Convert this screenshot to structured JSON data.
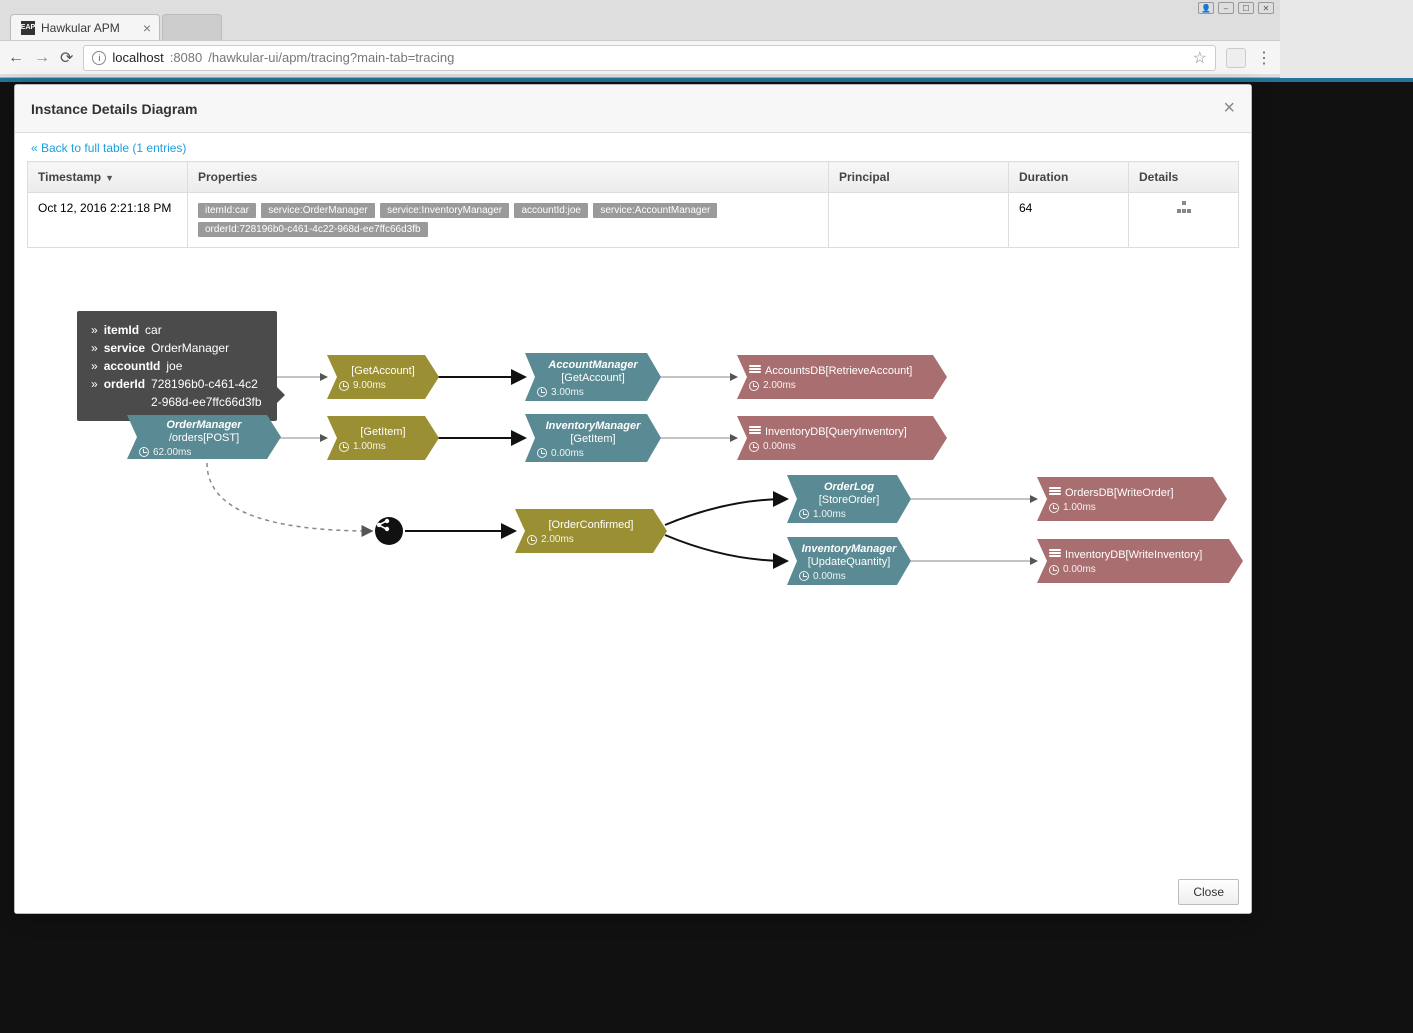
{
  "browser": {
    "tab_title": "Hawkular APM",
    "url_host": "localhost",
    "url_port": ":8080",
    "url_path": "/hawkular-ui/apm/tracing?main-tab=tracing"
  },
  "modal": {
    "title": "Instance Details Diagram",
    "back_link": "« Back to full table (1 entries)",
    "close_label": "Close"
  },
  "table": {
    "headers": {
      "timestamp": "Timestamp",
      "properties": "Properties",
      "principal": "Principal",
      "duration": "Duration",
      "details": "Details"
    },
    "row": {
      "timestamp": "Oct 12, 2016 2:21:18 PM",
      "tags": [
        "itemId:car",
        "service:OrderManager",
        "service:InventoryManager",
        "accountId:joe",
        "service:AccountManager",
        "orderId:728196b0-c461-4c22-968d-ee7ffc66d3fb"
      ],
      "principal": "",
      "duration": "64"
    }
  },
  "tooltip": {
    "lines": [
      {
        "k": "itemId",
        "v": "car"
      },
      {
        "k": "service",
        "v": "OrderManager"
      },
      {
        "k": "accountId",
        "v": "joe"
      },
      {
        "k": "orderId",
        "v": "728196b0-c461-4c22-968d-ee7ffc66d3fb"
      }
    ]
  },
  "nodes": {
    "order_manager": {
      "title": "OrderManager",
      "sub": "/orders[POST]",
      "time": "62.00ms"
    },
    "get_account": {
      "title": "[GetAccount]",
      "time": "9.00ms"
    },
    "get_item": {
      "title": "[GetItem]",
      "time": "1.00ms"
    },
    "account_mgr": {
      "title": "AccountManager",
      "sub": "[GetAccount]",
      "time": "3.00ms"
    },
    "inventory_mgr": {
      "title": "InventoryManager",
      "sub": "[GetItem]",
      "time": "0.00ms"
    },
    "order_confirmed": {
      "title": "[OrderConfirmed]",
      "time": "2.00ms"
    },
    "accounts_db": {
      "title": "AccountsDB[RetrieveAccount]",
      "time": "2.00ms"
    },
    "inventory_db_q": {
      "title": "InventoryDB[QueryInventory]",
      "time": "0.00ms"
    },
    "order_log": {
      "title": "OrderLog",
      "sub": "[StoreOrder]",
      "time": "1.00ms"
    },
    "inv_mgr_upd": {
      "title": "InventoryManager",
      "sub": "[UpdateQuantity]",
      "time": "0.00ms"
    },
    "orders_db": {
      "title": "OrdersDB[WriteOrder]",
      "time": "1.00ms"
    },
    "inventory_db_w": {
      "title": "InventoryDB[WriteInventory]",
      "time": "0.00ms"
    }
  }
}
